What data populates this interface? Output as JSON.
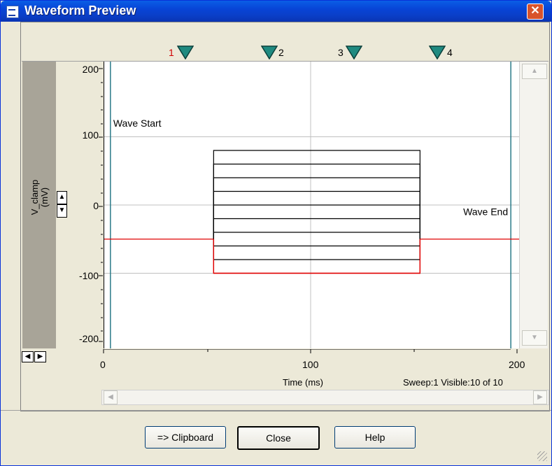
{
  "window": {
    "title": "Waveform Preview",
    "close_glyph": "✕",
    "icon": "waveform-app-icon"
  },
  "cursors": [
    {
      "label": "1",
      "color": "#d00000"
    },
    {
      "label": "2",
      "color": "#000000"
    },
    {
      "label": "3",
      "color": "#000000"
    },
    {
      "label": "4",
      "color": "#000000"
    }
  ],
  "chart_data": {
    "type": "line",
    "ylabel_line1": "V_clamp",
    "ylabel_line2": "(mV)",
    "xlabel": "Time (ms)",
    "xlim": [
      0,
      200
    ],
    "ylim": [
      -200,
      200
    ],
    "x_ticks": [
      "0",
      "100",
      "200"
    ],
    "y_ticks": [
      "200",
      "100",
      "0",
      "-100",
      "-200"
    ],
    "annotations": {
      "start": "Wave Start",
      "end": "Wave End"
    },
    "holding_level": -50,
    "step_start": 53,
    "step_end": 153,
    "wave_start": 3,
    "wave_end": 197,
    "sweep_levels": [
      -100,
      -80,
      -60,
      -40,
      -20,
      0,
      20,
      40,
      60,
      80
    ],
    "highlight_sweep_level": -100,
    "colors": {
      "active_sweep": "#e00000",
      "other_sweeps": "#000000",
      "grid": "#c0c0c0",
      "marker_line": "#2a7a88"
    }
  },
  "status": {
    "sweep_text": "Sweep:1 Visible:10 of 10"
  },
  "buttons": {
    "clipboard": "=> Clipboard",
    "close": "Close",
    "help": "Help"
  },
  "scroll_glyphs": {
    "up": "▲",
    "down": "▼",
    "left": "◀",
    "right": "▶"
  }
}
